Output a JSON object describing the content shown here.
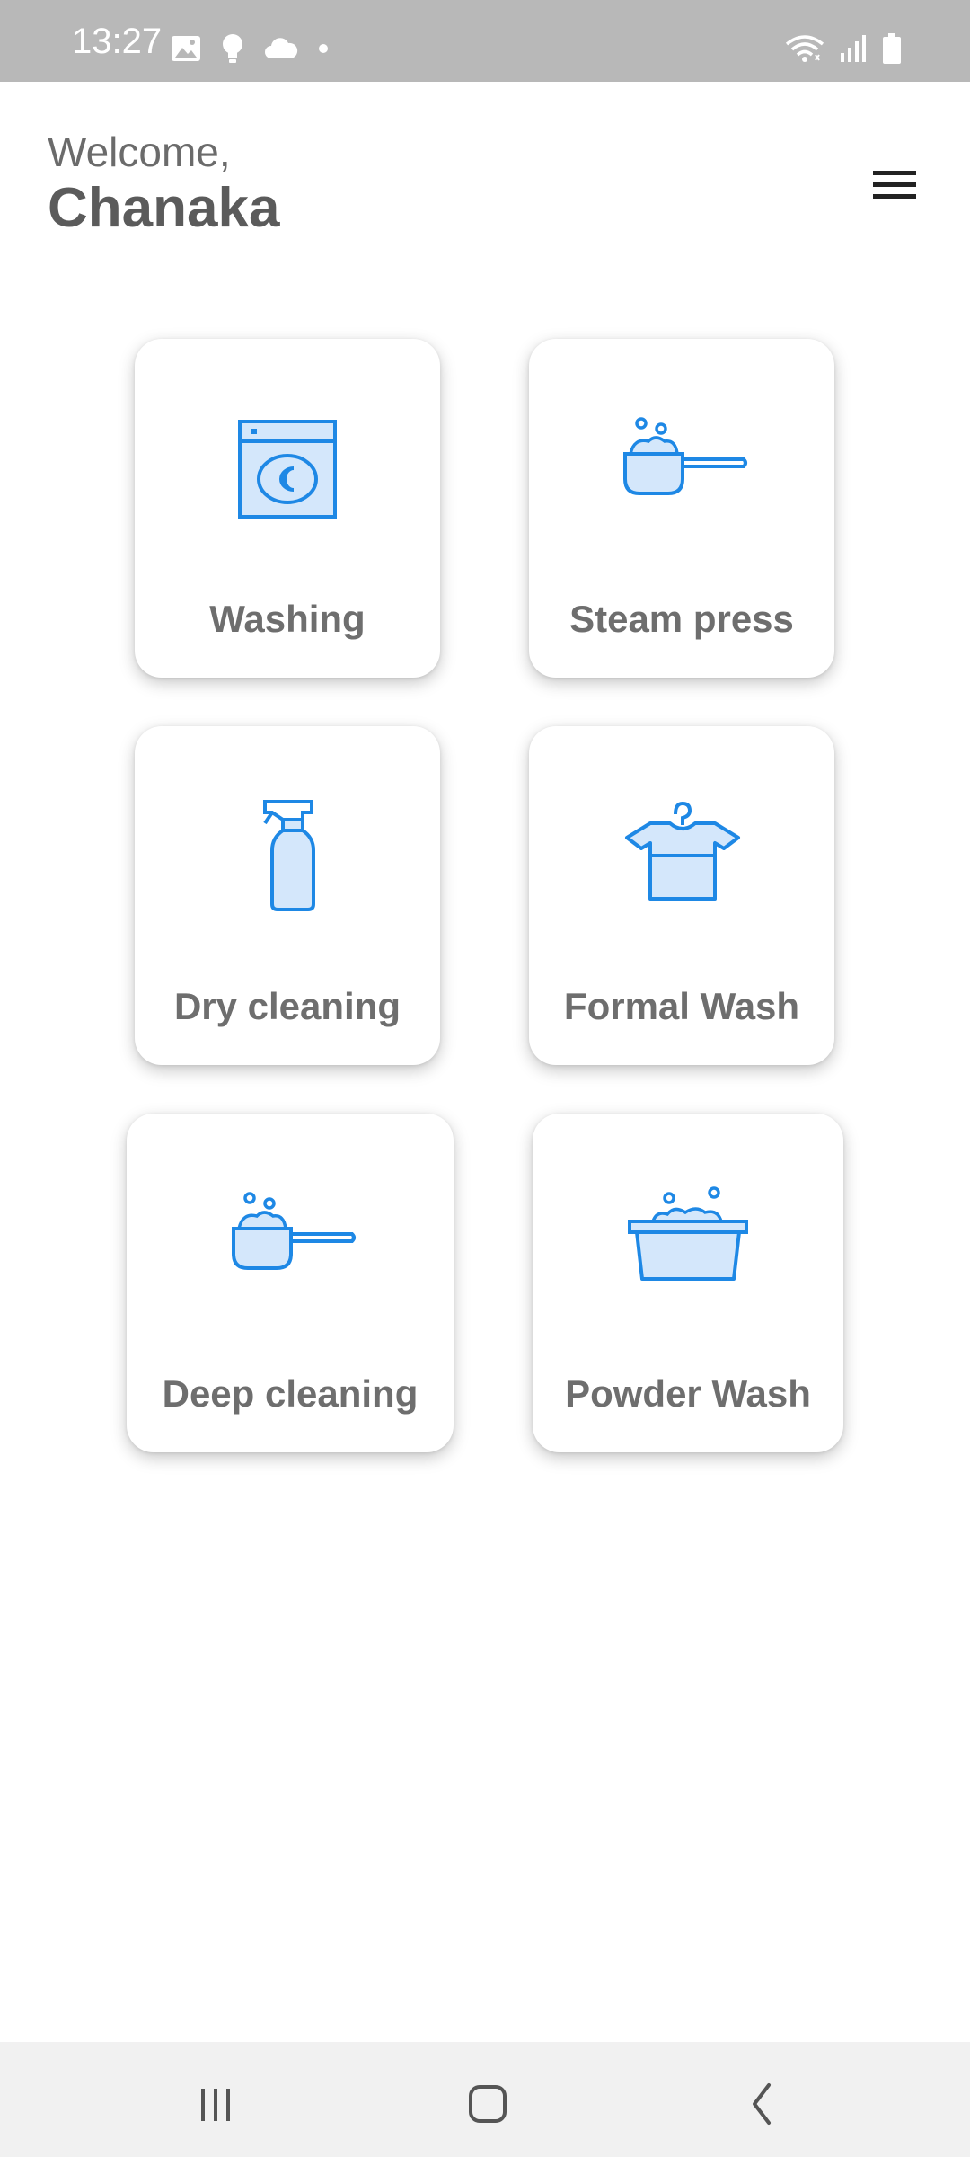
{
  "status_bar": {
    "time": "13:27",
    "left_icons": [
      "image-icon",
      "bulb-icon",
      "cloud-icon",
      "dot-icon"
    ],
    "right_icons": [
      "wifi-icon",
      "signal-icon",
      "battery-icon"
    ]
  },
  "header": {
    "greeting": "Welcome,",
    "user_name": "Chanaka",
    "menu_icon": "hamburger-menu-icon"
  },
  "services": [
    {
      "label": "Washing",
      "icon": "washing-machine-icon"
    },
    {
      "label": "Steam press",
      "icon": "steam-press-icon"
    },
    {
      "label": "Dry cleaning",
      "icon": "spray-bottle-icon"
    },
    {
      "label": "Formal Wash",
      "icon": "shirt-hanger-icon"
    },
    {
      "label": "Deep cleaning",
      "icon": "detergent-scoop-icon"
    },
    {
      "label": "Powder Wash",
      "icon": "wash-basin-icon"
    }
  ],
  "nav_bar": {
    "buttons": [
      "recent-apps-icon",
      "home-icon",
      "back-icon"
    ]
  },
  "colors": {
    "accent": "#1e88e5",
    "icon_fill": "#d4e7fb",
    "status_bar": "#b8b8b8",
    "nav_bar": "#f1f1f1",
    "label_text": "#6e6e6e"
  }
}
